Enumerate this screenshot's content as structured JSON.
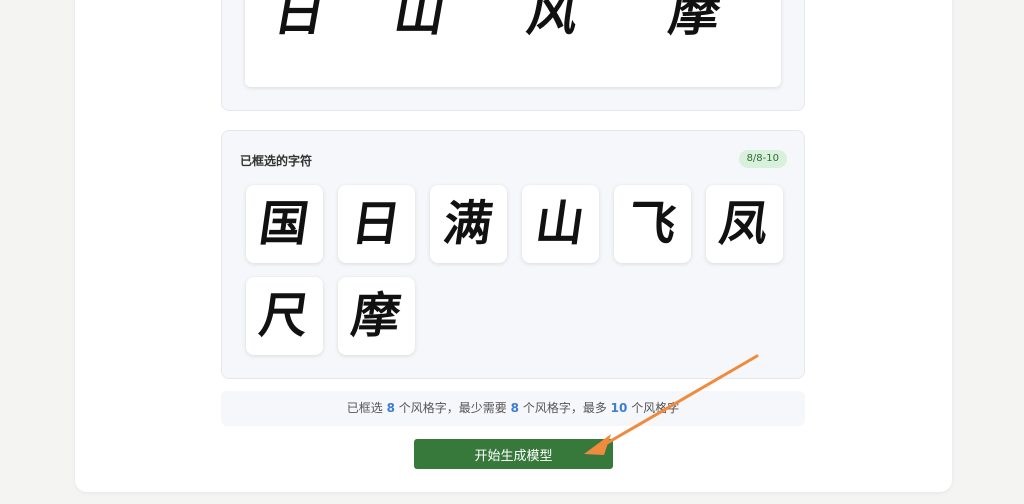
{
  "preview": {
    "chars": [
      "日",
      "山",
      "风",
      "摩"
    ]
  },
  "selected_section": {
    "title": "已框选的字符",
    "badge": "8/8-10",
    "chars": [
      "国",
      "日",
      "满",
      "山",
      "飞",
      "凤",
      "尺",
      "摩"
    ]
  },
  "info_bar": {
    "prefix": "已框选",
    "selected_count": "8",
    "middle1": "个风格字，最少需要",
    "min_count": "8",
    "middle2": "个风格字，最多",
    "max_count": "10",
    "suffix": "个风格字"
  },
  "action": {
    "start_label": "开始生成模型"
  },
  "colors": {
    "button_bg": "#37783b",
    "badge_bg": "#d9f0dc",
    "number_accent": "#3b7fd1",
    "annotation_arrow": "#f08a3c"
  }
}
